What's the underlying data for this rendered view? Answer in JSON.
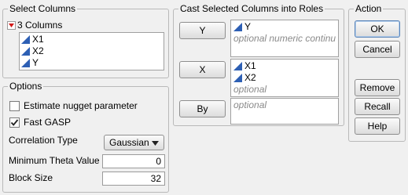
{
  "select_columns": {
    "title": "Select Columns",
    "count_label": "3 Columns",
    "columns": [
      "X1",
      "X2",
      "Y"
    ]
  },
  "options": {
    "title": "Options",
    "estimate_nugget": {
      "label": "Estimate nugget parameter",
      "checked": false
    },
    "fast_gasp": {
      "label": "Fast GASP",
      "checked": true
    },
    "correlation_type": {
      "label": "Correlation Type",
      "value": "Gaussian"
    },
    "min_theta": {
      "label": "Minimum Theta Value",
      "value": "0"
    },
    "block_size": {
      "label": "Block Size",
      "value": "32"
    }
  },
  "cast_roles": {
    "title": "Cast Selected Columns into Roles",
    "y": {
      "button": "Y",
      "items": [
        "Y"
      ],
      "placeholder": "optional numeric continuous"
    },
    "x": {
      "button": "X",
      "items": [
        "X1",
        "X2"
      ],
      "placeholder": "optional"
    },
    "by": {
      "button": "By",
      "items": [],
      "placeholder": "optional"
    }
  },
  "action": {
    "title": "Action",
    "ok": "OK",
    "cancel": "Cancel",
    "remove": "Remove",
    "recall": "Recall",
    "help": "Help"
  }
}
